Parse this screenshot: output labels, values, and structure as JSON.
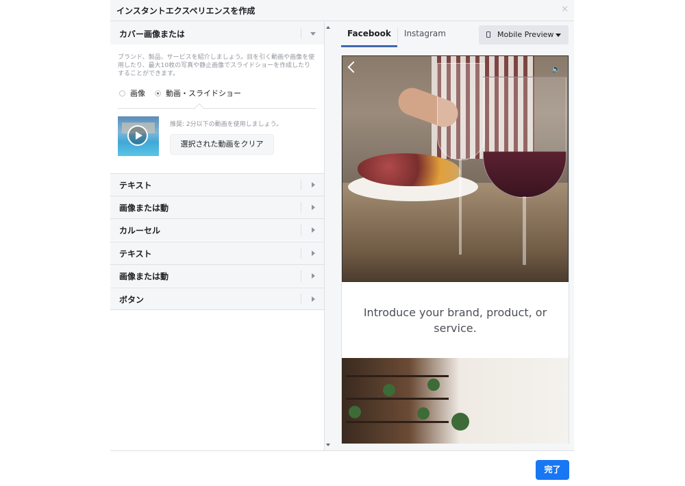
{
  "dialog": {
    "title": "インスタントエクスペリエンスを作成",
    "close_glyph": "×"
  },
  "cover_section": {
    "title": "カバー画像または動画",
    "description": "ブランド、製品、サービスを紹介しましょう。目を引く動画や画像を使用したり、最大10枚の写真や静止画像でスライドショーを作成したりすることができます。",
    "radio_options": [
      {
        "label": "画像",
        "selected": false
      },
      {
        "label": "動画・スライドショー",
        "selected": true
      }
    ],
    "recommendation": "推奨: 2分以下の動画を使用しましょう。",
    "clear_button": "選択された動画をクリア"
  },
  "sections": [
    {
      "label": "テキスト"
    },
    {
      "label": "画像または動画"
    },
    {
      "label": "カルーセル"
    },
    {
      "label": "テキスト"
    },
    {
      "label": "画像または動画"
    },
    {
      "label": "ボタン"
    }
  ],
  "preview": {
    "tabs": [
      {
        "label": "Facebook",
        "active": true
      },
      {
        "label": "Instagram",
        "active": false
      }
    ],
    "dropdown_label": "Mobile Preview",
    "intro_text": "Introduce your brand, product, or service.",
    "sound_glyph": "🔈"
  },
  "footer": {
    "done_button": "完了"
  },
  "colors": {
    "primary": "#1877f2",
    "tab_underline": "#4267b2",
    "panel_bg": "#f5f6f7",
    "border": "#dddfe2",
    "muted_text": "#90949c"
  }
}
